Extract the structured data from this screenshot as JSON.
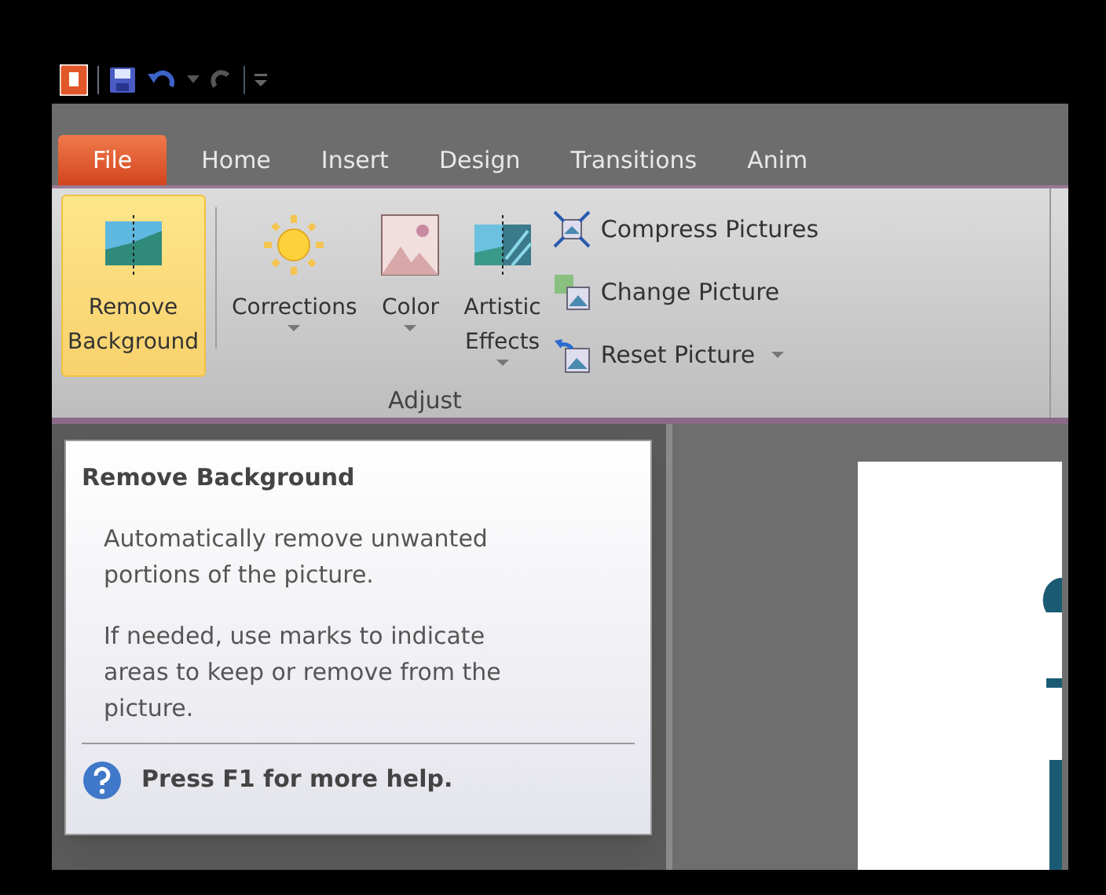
{
  "tabs": [
    {
      "label": "File",
      "kind": "file"
    },
    {
      "label": "Home",
      "kind": "tab"
    },
    {
      "label": "Insert",
      "kind": "tab"
    },
    {
      "label": "Design",
      "kind": "tab"
    },
    {
      "label": "Transitions",
      "kind": "tab"
    },
    {
      "label": "Anim",
      "kind": "tab"
    }
  ],
  "ribbon_group": {
    "label": "Adjust",
    "large_buttons": [
      {
        "label": "Remove Background",
        "kind": "remove-background",
        "highlighted": true,
        "dropdown": false
      },
      {
        "label": "Corrections",
        "kind": "corrections",
        "highlighted": false,
        "dropdown": true
      },
      {
        "label": "Color",
        "kind": "color",
        "highlighted": false,
        "dropdown": true
      },
      {
        "label": "Artistic Effects",
        "kind": "artistic",
        "highlighted": false,
        "dropdown": true
      }
    ],
    "small_buttons": [
      {
        "label": "Compress Pictures",
        "kind": "compress",
        "dropdown": false
      },
      {
        "label": "Change Picture",
        "kind": "change",
        "dropdown": false
      },
      {
        "label": "Reset Picture",
        "kind": "reset",
        "dropdown": true
      }
    ]
  },
  "tooltip": {
    "title": "Remove Background",
    "paragraphs": [
      "Automatically remove unwanted portions of the picture.",
      "If needed, use marks to indicate areas to keep or remove from the picture."
    ],
    "help": "Press F1 for more help."
  }
}
